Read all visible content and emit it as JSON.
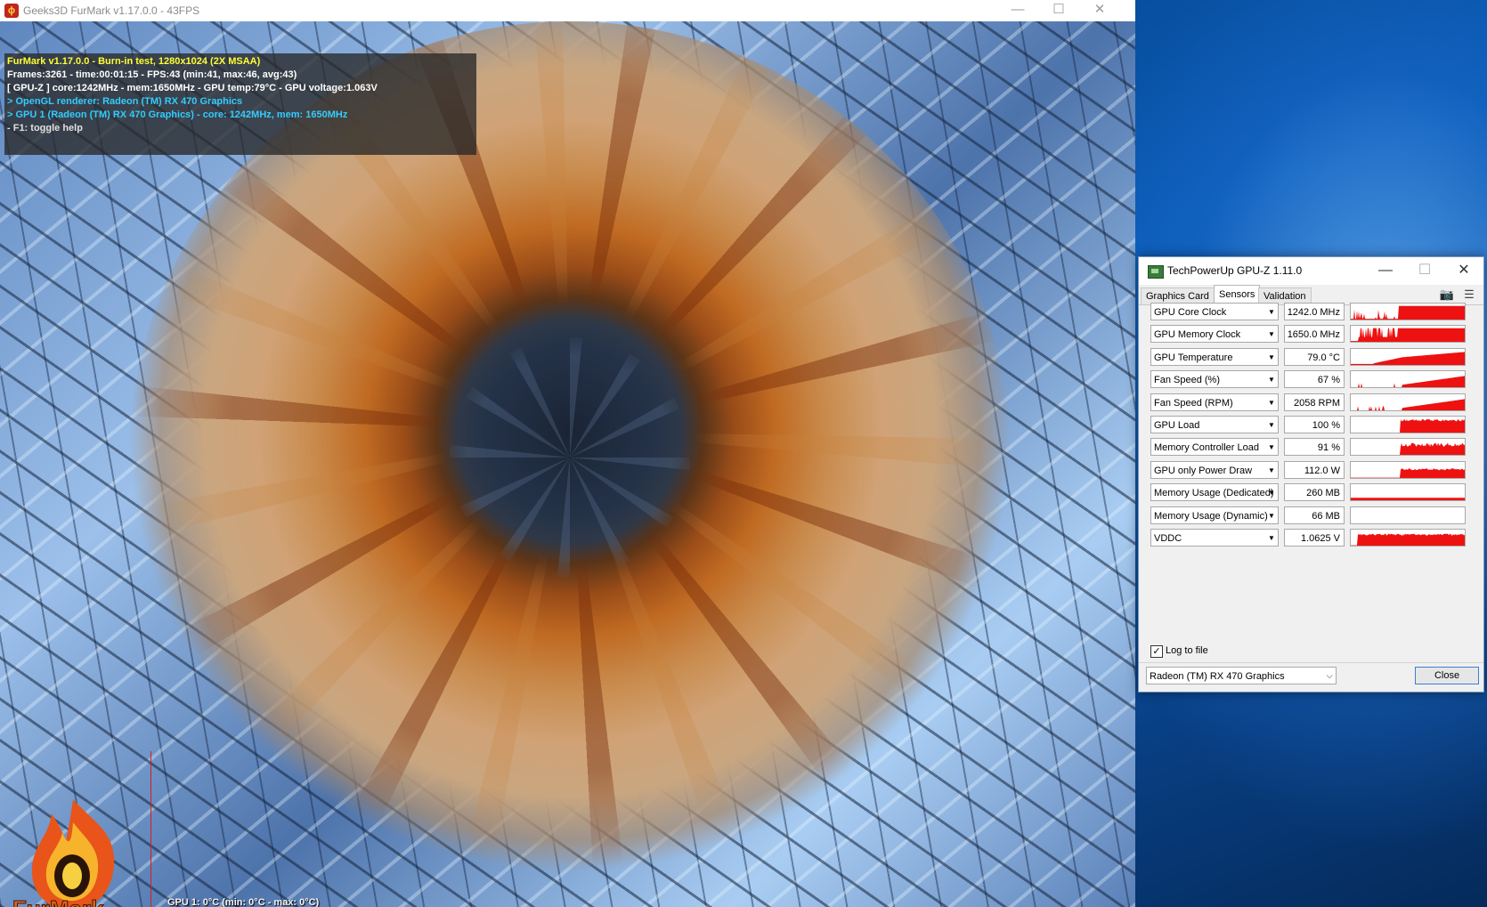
{
  "furmark": {
    "window_title": "Geeks3D FurMark v1.17.0.0 - 43FPS",
    "controls": {
      "minimize": "—",
      "maximize": "☐",
      "close": "✕"
    },
    "osd_lines": [
      {
        "text": "FurMark v1.17.0.0 - Burn-in test, 1280x1024 (2X MSAA)",
        "color": "#ffff33"
      },
      {
        "text": "Frames:3261 - time:00:01:15 - FPS:43 (min:41, max:46, avg:43)",
        "color": "#ffffff"
      },
      {
        "text": "[ GPU-Z ] core:1242MHz - mem:1650MHz - GPU temp:79°C - GPU voltage:1.063V",
        "color": "#ffffff"
      },
      {
        "text": "> OpenGL renderer: Radeon (TM) RX 470 Graphics",
        "color": "#33ccff"
      },
      {
        "text": "> GPU 1 (Radeon (TM) RX 470 Graphics) - core: 1242MHz, mem: 1650MHz",
        "color": "#33ccff"
      },
      {
        "text": "- F1: toggle help",
        "color": "#e0e0e0"
      }
    ],
    "temp_graph_label": "GPU 1: 0°C (min: 0°C - max: 0°C)",
    "logo_icon": "furmark-flame-logo"
  },
  "gpuz": {
    "window_title": "TechPowerUp GPU-Z 1.11.0",
    "controls": {
      "minimize": "—",
      "maximize": "☐",
      "close": "✕"
    },
    "tabs": [
      {
        "label": "Graphics Card",
        "active": false
      },
      {
        "label": "Sensors",
        "active": true
      },
      {
        "label": "Validation",
        "active": false
      }
    ],
    "toolbar_icons": {
      "camera": "camera-icon",
      "menu": "hamburger-menu-icon"
    },
    "graph_color": "#ee1111",
    "sensors": [
      {
        "name": "GPU Core Clock",
        "value": "1242.0 MHz",
        "graph": "spiky-high"
      },
      {
        "name": "GPU Memory Clock",
        "value": "1650.0 MHz",
        "graph": "spiky-full"
      },
      {
        "name": "GPU Temperature",
        "value": "79.0 °C",
        "graph": "ramp"
      },
      {
        "name": "Fan Speed (%)",
        "value": "67 %",
        "graph": "ramp-low"
      },
      {
        "name": "Fan Speed (RPM)",
        "value": "2058 RPM",
        "graph": "ramp-low"
      },
      {
        "name": "GPU Load",
        "value": "100 %",
        "graph": "block"
      },
      {
        "name": "Memory Controller Load",
        "value": "91 %",
        "graph": "block-noisy"
      },
      {
        "name": "GPU only Power Draw",
        "value": "112.0 W",
        "graph": "block-low"
      },
      {
        "name": "Memory Usage (Dedicated)",
        "value": "260 MB",
        "graph": "flat"
      },
      {
        "name": "Memory Usage (Dynamic)",
        "value": "66 MB",
        "graph": "empty"
      },
      {
        "name": "VDDC",
        "value": "1.0625 V",
        "graph": "full"
      }
    ],
    "log_to_file": {
      "label": "Log to file",
      "checked": true
    },
    "gpu_select": "Radeon (TM) RX 470 Graphics",
    "close_button": "Close"
  }
}
